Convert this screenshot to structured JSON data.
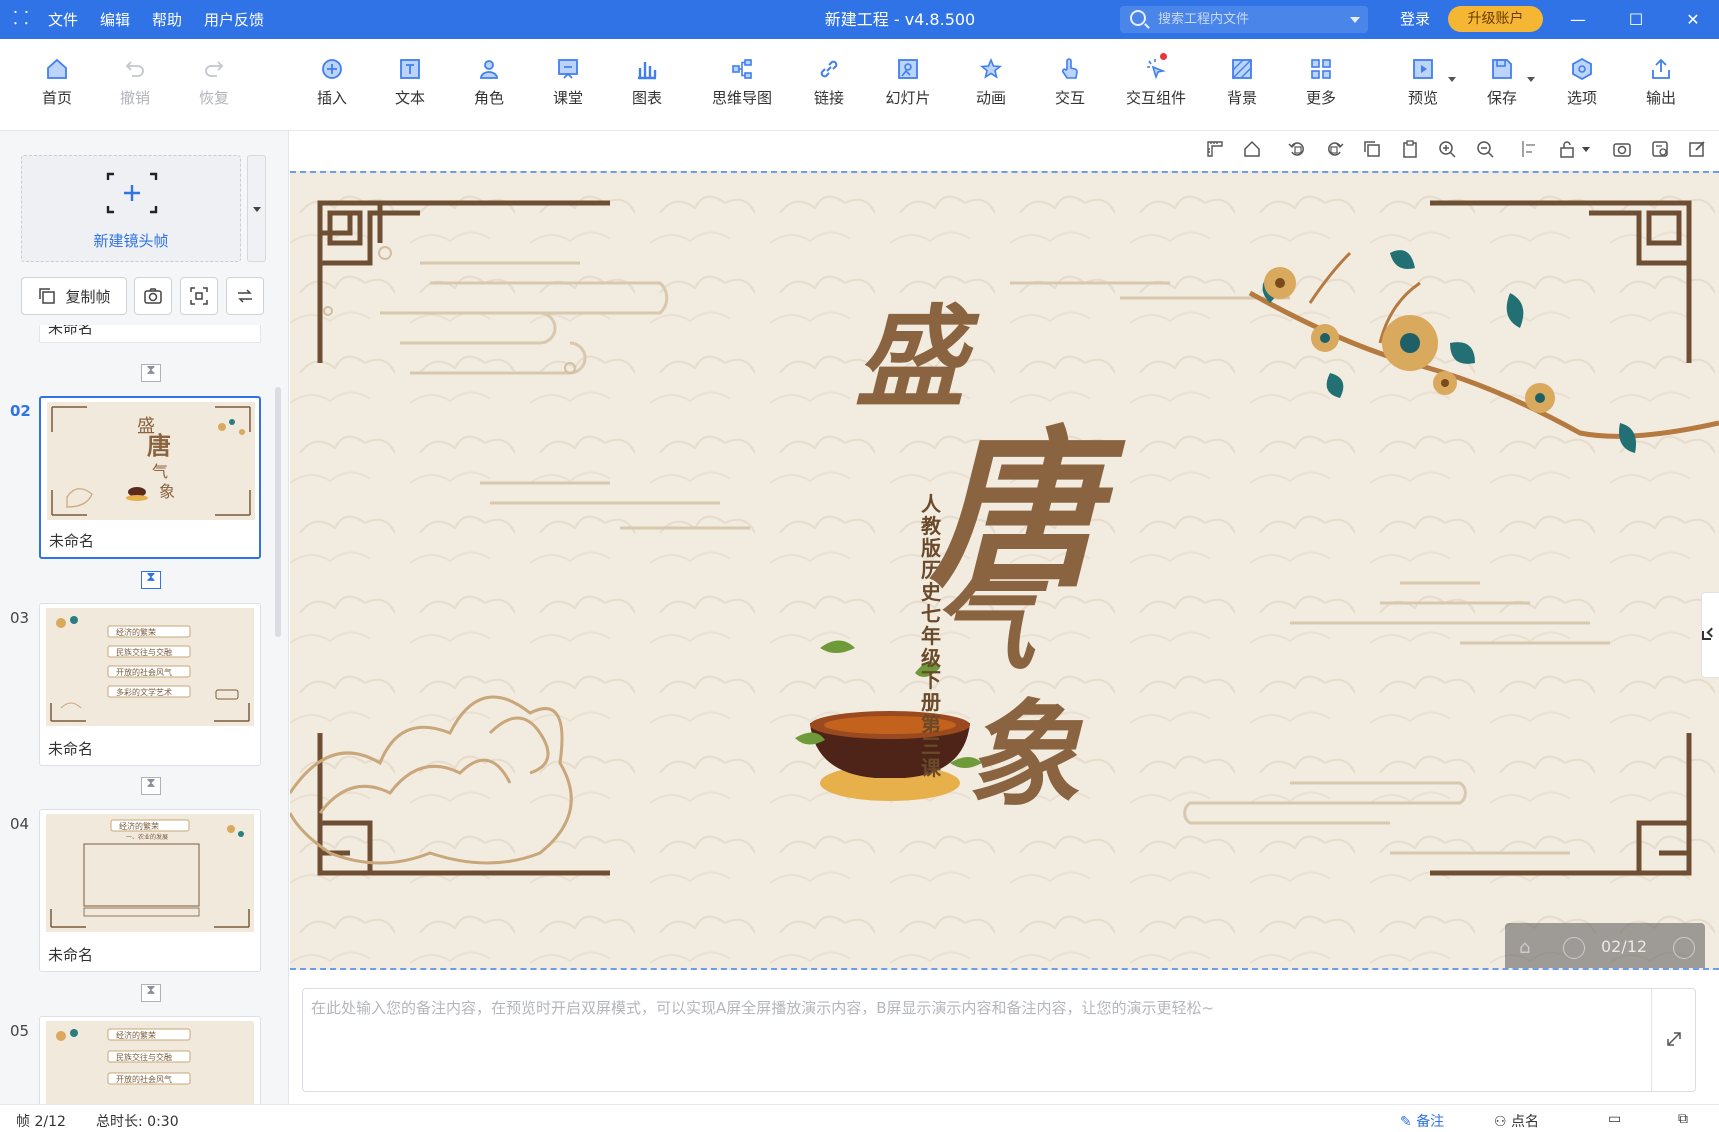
{
  "titlebar": {
    "menu": [
      "文件",
      "编辑",
      "帮助",
      "用户反馈"
    ],
    "title": "新建工程 - v4.8.500",
    "search_placeholder": "搜索工程内文件",
    "login": "登录",
    "upgrade": "升级账户"
  },
  "toolbar": {
    "home": "首页",
    "undo": "撤销",
    "redo": "恢复",
    "insert": "插入",
    "text": "文本",
    "role": "角色",
    "classroom": "课堂",
    "chart": "图表",
    "mindmap": "思维导图",
    "link": "链接",
    "slideshow": "幻灯片",
    "animation": "动画",
    "interact": "交互",
    "interactive_widget": "交互组件",
    "background": "背景",
    "more": "更多",
    "preview": "预览",
    "save": "保存",
    "options": "选项",
    "export": "输出"
  },
  "leftpanel": {
    "new_frame": "新建镜头帧",
    "copy_frame": "复制帧",
    "partial_name": "未命名",
    "frames": [
      {
        "num": "02",
        "name": "未命名"
      },
      {
        "num": "03",
        "name": "未命名"
      },
      {
        "num": "04",
        "name": "未命名"
      },
      {
        "num": "05",
        "name": ""
      }
    ],
    "thumb_items_03": [
      "经济的繁荣",
      "民族交往与交融",
      "开放的社会风气",
      "多彩的文学艺术"
    ],
    "thumb_items_04": [
      "经济的繁荣",
      "一、农业的发展"
    ],
    "thumb_items_05": [
      "经济的繁荣",
      "民族交往与交融",
      "开放的社会风气"
    ]
  },
  "slide": {
    "title_chars": [
      "盛",
      "唐",
      "气",
      "象"
    ],
    "subtitle": "人教版历史七年级下册第三课",
    "pager": "02/12"
  },
  "notes": {
    "placeholder": "在此处输入您的备注内容，在预览时开启双屏模式，可以实现A屏全屏播放演示内容，B屏显示演示内容和备注内容，让您的演示更轻松~"
  },
  "status": {
    "frame": "帧 2/12",
    "duration": "总时长: 0:30",
    "notes_btn": "备注",
    "rollcall_btn": "点名"
  },
  "colors": {
    "accent": "#2f73e6",
    "upgrade": "#f5b733",
    "title_brown": "#8a6440"
  }
}
